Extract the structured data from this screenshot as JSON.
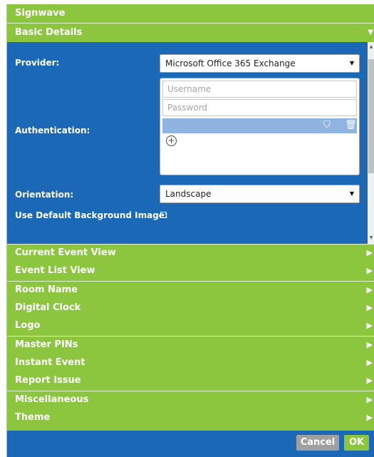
{
  "app": {
    "title": "Signwave"
  },
  "basic_details": {
    "header": "Basic Details",
    "provider_label": "Provider:",
    "provider_value": "Microsoft Office 365 Exchange",
    "authentication_label": "Authentication:",
    "username_placeholder": "Username",
    "password_placeholder": "Password",
    "orientation_label": "Orientation:",
    "orientation_value": "Landscape",
    "default_bg_label": "Use Default Background Image:",
    "default_bg_checked": false
  },
  "sections": [
    {
      "label": "Current Event View"
    },
    {
      "label": "Event List View"
    },
    {
      "label": "Room Name"
    },
    {
      "label": "Digital Clock"
    },
    {
      "label": "Logo"
    },
    {
      "label": "Master PINs"
    },
    {
      "label": "Instant Event"
    },
    {
      "label": "Report Issue"
    },
    {
      "label": "Miscellaneous"
    },
    {
      "label": "Theme"
    }
  ],
  "footer": {
    "cancel_label": "Cancel",
    "ok_label": "OK"
  },
  "colors": {
    "green": "#8cc63f",
    "blue": "#1b69b6",
    "selected_row": "#8fb4e0",
    "cancel_gray": "#a0a0a0"
  },
  "icons": {
    "expanded": "triangle-down-icon",
    "collapsed": "triangle-right-icon",
    "shield": "shield-icon",
    "trash": "trash-icon",
    "add": "add-circle-icon",
    "dropdown": "caret-down-icon"
  }
}
